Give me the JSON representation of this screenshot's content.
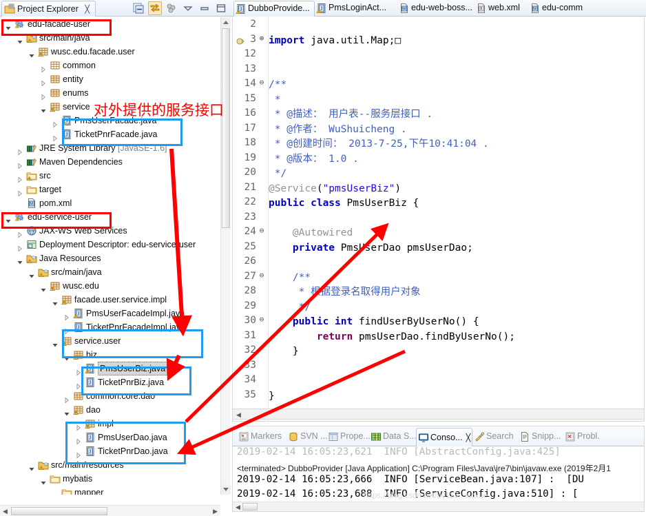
{
  "explorer": {
    "tab_label": "Project Explorer",
    "tab_close": "╳",
    "toolbar": [
      {
        "name": "collapse-all-icon",
        "label": "Collapse All"
      },
      {
        "name": "link-with-editor-icon",
        "label": "Link with Editor"
      },
      {
        "name": "view-menu-filter-icon",
        "label": "Filters"
      },
      {
        "name": "view-menu-icon",
        "label": "View Menu"
      },
      {
        "name": "minimize-icon",
        "label": "Minimize"
      },
      {
        "name": "maximize-icon",
        "label": "Maximize"
      }
    ],
    "tree": [
      {
        "label": "edu-facade-user",
        "indent": 0,
        "icon": "maven-java-project",
        "twisty": "open"
      },
      {
        "label": "src/main/java",
        "indent": 1,
        "icon": "source-folder",
        "twisty": "open"
      },
      {
        "label": "wusc.edu.facade.user",
        "indent": 2,
        "icon": "package-warn",
        "twisty": "open"
      },
      {
        "label": "common",
        "indent": 3,
        "icon": "package-empty",
        "twisty": "closed"
      },
      {
        "label": "entity",
        "indent": 3,
        "icon": "package",
        "twisty": "closed"
      },
      {
        "label": "enums",
        "indent": 3,
        "icon": "package",
        "twisty": "closed"
      },
      {
        "label": "service",
        "indent": 3,
        "icon": "package-warn",
        "twisty": "open"
      },
      {
        "label": "PmsUserFacade.java",
        "indent": 4,
        "icon": "java-interface-warn",
        "twisty": "closed"
      },
      {
        "label": "TicketPnrFacade.java",
        "indent": 4,
        "icon": "java-interface",
        "twisty": "closed"
      },
      {
        "label": "JRE System Library",
        "suffix": " [JavaSE-1.6]",
        "indent": 1,
        "icon": "library",
        "twisty": "closed"
      },
      {
        "label": "Maven Dependencies",
        "indent": 1,
        "icon": "library",
        "twisty": "closed"
      },
      {
        "label": "src",
        "indent": 1,
        "icon": "folder-warn",
        "twisty": "closed"
      },
      {
        "label": "target",
        "indent": 1,
        "icon": "folder",
        "twisty": "closed"
      },
      {
        "label": "pom.xml",
        "indent": 1,
        "icon": "maven-file",
        "twisty": "none"
      },
      {
        "label": "edu-service-user",
        "indent": 0,
        "icon": "maven-java-project",
        "twisty": "open"
      },
      {
        "label": "JAX-WS Web Services",
        "indent": 1,
        "icon": "jaxws",
        "twisty": "closed"
      },
      {
        "label": "Deployment Descriptor: edu-service-user",
        "indent": 1,
        "icon": "deployment",
        "twisty": "closed"
      },
      {
        "label": "Java Resources",
        "indent": 1,
        "icon": "java-resources",
        "twisty": "open"
      },
      {
        "label": "src/main/java",
        "indent": 2,
        "icon": "source-folder",
        "twisty": "open"
      },
      {
        "label": "wusc.edu",
        "indent": 3,
        "icon": "package-warn",
        "twisty": "open"
      },
      {
        "label": "facade.user.service.impl",
        "indent": 4,
        "icon": "package-warn",
        "twisty": "open"
      },
      {
        "label": "PmsUserFacadeImpl.java",
        "indent": 5,
        "icon": "java-class-warn",
        "twisty": "closed"
      },
      {
        "label": "TicketPnrFacadeImpl.java",
        "indent": 5,
        "icon": "java-class",
        "twisty": "closed"
      },
      {
        "label": "service.user",
        "indent": 4,
        "icon": "package-warn",
        "twisty": "open"
      },
      {
        "label": "biz",
        "indent": 5,
        "icon": "package-warn",
        "twisty": "open"
      },
      {
        "label": "PmsUserBiz.java",
        "indent": 6,
        "icon": "java-class-warn",
        "twisty": "closed",
        "selected": true
      },
      {
        "label": "TicketPnrBiz.java",
        "indent": 6,
        "icon": "java-class",
        "twisty": "closed"
      },
      {
        "label": "common.core.dao",
        "indent": 5,
        "icon": "package",
        "twisty": "closed"
      },
      {
        "label": "dao",
        "indent": 5,
        "icon": "package-warn",
        "twisty": "open"
      },
      {
        "label": "impl",
        "indent": 6,
        "icon": "package-warn",
        "twisty": "closed"
      },
      {
        "label": "PmsUserDao.java",
        "indent": 6,
        "icon": "java-interface",
        "twisty": "closed"
      },
      {
        "label": "TicketPnrDao.java",
        "indent": 6,
        "icon": "java-interface",
        "twisty": "closed"
      },
      {
        "label": "src/main/resources",
        "indent": 2,
        "icon": "source-folder",
        "twisty": "open"
      },
      {
        "label": "mybatis",
        "indent": 3,
        "icon": "folder",
        "twisty": "open"
      },
      {
        "label": "mapper",
        "indent": 4,
        "icon": "folder",
        "twisty": "open"
      }
    ]
  },
  "editor": {
    "tabs": [
      {
        "label": "DubboProvide...",
        "icon": "java-class-warn",
        "active": true
      },
      {
        "label": "PmsLoginAct...",
        "icon": "java-class-warn",
        "active": false
      },
      {
        "label": "edu-web-boss...",
        "icon": "maven-file",
        "active": false
      },
      {
        "label": "web.xml",
        "icon": "xml-file",
        "active": false
      },
      {
        "label": "edu-comm",
        "icon": "maven-file",
        "active": false
      }
    ],
    "lines": [
      {
        "num": "2",
        "fold": "",
        "segments": [
          {
            "t": "",
            "c": "pl"
          }
        ]
      },
      {
        "num": "3",
        "fold": "⊕",
        "segments": [
          {
            "t": "import",
            "c": "kb"
          },
          {
            "t": " ",
            "c": "pl"
          },
          {
            "t": "java.util.Map;",
            "c": "pl"
          },
          {
            "t": "□",
            "c": "pl"
          }
        ]
      },
      {
        "num": "12",
        "fold": "",
        "segments": []
      },
      {
        "num": "13",
        "fold": "",
        "segments": []
      },
      {
        "num": "14",
        "fold": "⊖",
        "segments": [
          {
            "t": "/**",
            "c": "cm"
          }
        ]
      },
      {
        "num": "15",
        "fold": "",
        "segments": [
          {
            "t": " *",
            "c": "cm"
          }
        ]
      },
      {
        "num": "16",
        "fold": "",
        "segments": [
          {
            "t": " * @描述： 用户表--服务层接口 .",
            "c": "cm"
          }
        ]
      },
      {
        "num": "17",
        "fold": "",
        "segments": [
          {
            "t": " * @作者： WuShuicheng .",
            "c": "cm"
          }
        ]
      },
      {
        "num": "18",
        "fold": "",
        "segments": [
          {
            "t": " * @创建时间： 2013-7-25,下午10:41:04 .",
            "c": "cm"
          }
        ]
      },
      {
        "num": "19",
        "fold": "",
        "segments": [
          {
            "t": " * @版本： 1.0 .",
            "c": "cm"
          }
        ]
      },
      {
        "num": "20",
        "fold": "",
        "segments": [
          {
            "t": " */",
            "c": "cm"
          }
        ]
      },
      {
        "num": "21",
        "fold": "",
        "segments": [
          {
            "t": "@Service",
            "c": "ann"
          },
          {
            "t": "(",
            "c": "pl"
          },
          {
            "t": "\"pmsUserBiz\"",
            "c": "str"
          },
          {
            "t": ")",
            "c": "pl"
          }
        ]
      },
      {
        "num": "22",
        "fold": "",
        "segments": [
          {
            "t": "public class",
            "c": "kb"
          },
          {
            "t": " PmsUserBiz {",
            "c": "pl"
          }
        ]
      },
      {
        "num": "23",
        "fold": "",
        "segments": []
      },
      {
        "num": "24",
        "fold": "⊖",
        "segments": [
          {
            "t": "    @Autowired",
            "c": "ann"
          }
        ]
      },
      {
        "num": "25",
        "fold": "",
        "segments": [
          {
            "t": "    ",
            "c": "pl"
          },
          {
            "t": "private",
            "c": "kb"
          },
          {
            "t": " PmsUserDao pmsUserDao;",
            "c": "pl"
          }
        ]
      },
      {
        "num": "26",
        "fold": "",
        "segments": []
      },
      {
        "num": "27",
        "fold": "⊖",
        "segments": [
          {
            "t": "    /**",
            "c": "cm"
          }
        ]
      },
      {
        "num": "28",
        "fold": "",
        "segments": [
          {
            "t": "     * 根据登录名取得用户对象",
            "c": "cm"
          }
        ]
      },
      {
        "num": "29",
        "fold": "",
        "segments": [
          {
            "t": "     */",
            "c": "cm"
          }
        ]
      },
      {
        "num": "30",
        "fold": "⊖",
        "segments": [
          {
            "t": "    ",
            "c": "pl"
          },
          {
            "t": "public int",
            "c": "kb"
          },
          {
            "t": " findUserByUserNo() {",
            "c": "pl"
          }
        ]
      },
      {
        "num": "31",
        "fold": "",
        "segments": [
          {
            "t": "        ",
            "c": "pl"
          },
          {
            "t": "return",
            "c": "k"
          },
          {
            "t": " pmsUserDao.findByUserNo();",
            "c": "pl"
          }
        ]
      },
      {
        "num": "32",
        "fold": "",
        "segments": [
          {
            "t": "    }",
            "c": "pl"
          }
        ]
      },
      {
        "num": "33",
        "fold": "",
        "segments": []
      },
      {
        "num": "34",
        "fold": "",
        "segments": []
      },
      {
        "num": "35",
        "fold": "",
        "segments": [
          {
            "t": "}",
            "c": "pl"
          }
        ]
      }
    ]
  },
  "console_panel": {
    "tabs": [
      {
        "label": "Markers",
        "icon": "markers-icon",
        "active": false
      },
      {
        "label": "SVN ...",
        "icon": "svn-icon",
        "active": false
      },
      {
        "label": "Prope...",
        "icon": "properties-icon",
        "active": false
      },
      {
        "label": "Data S...",
        "icon": "data-source-icon",
        "active": false
      },
      {
        "label": "Conso...",
        "icon": "console-icon",
        "active": true,
        "close": "╳"
      },
      {
        "label": "Search",
        "icon": "search-icon",
        "active": false
      },
      {
        "label": "Snipp...",
        "icon": "snippets-icon",
        "active": false
      },
      {
        "label": "Probl.",
        "icon": "problems-icon",
        "active": false
      }
    ],
    "header": "<terminated> DubboProvider [Java Application] C:\\Program Files\\Java\\jre7\\bin\\javaw.exe (2019年2月1",
    "lines": [
      "2019-02-14 16:05:23,666  INFO [ServiceBean.java:107] :  [DU",
      "2019-02-14 16:05:23,688  INFO [ServiceConfig.java:510] : ["
    ],
    "watermark": "https://blog.csdn.net/u0113...aicxue"
  },
  "annotations": {
    "service_interface_note": "对外提供的服务接口",
    "colors": {
      "red": "#ff0000",
      "blue": "#1e9cf0"
    }
  }
}
